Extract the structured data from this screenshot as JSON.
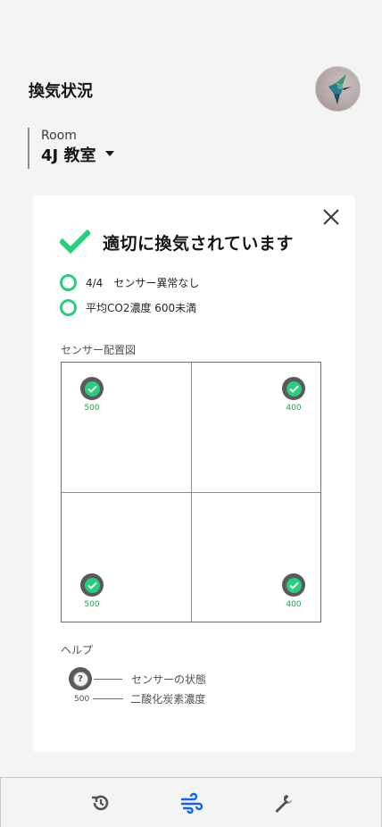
{
  "header": {
    "title": "換気状況"
  },
  "room": {
    "label": "Room",
    "value": "4J 教室"
  },
  "status": {
    "message": "適切に換気されています",
    "conditions": [
      {
        "text": "4/4　センサー異常なし"
      },
      {
        "text": "平均CO2濃度 600未満"
      }
    ]
  },
  "sensor_map": {
    "label": "センサー配置図",
    "sensors": [
      {
        "value": "500",
        "state": "ok"
      },
      {
        "value": "400",
        "state": "ok"
      },
      {
        "value": "500",
        "state": "ok"
      },
      {
        "value": "400",
        "state": "ok"
      }
    ]
  },
  "help": {
    "label": "ヘルプ",
    "items": [
      {
        "symbol": "?",
        "text": "センサーの状態"
      },
      {
        "symbol": "500",
        "text": "二酸化炭素濃度"
      }
    ]
  },
  "tabs": [
    {
      "name": "history",
      "icon": "history-icon",
      "active": false
    },
    {
      "name": "ventilation",
      "icon": "wind-icon",
      "active": true
    },
    {
      "name": "maintenance",
      "icon": "wrench-icon",
      "active": false
    }
  ],
  "colors": {
    "ok_green": "#24d07c",
    "value_green": "#24a148",
    "active_tab": "#0f62fe",
    "inactive_tab": "#525252"
  }
}
